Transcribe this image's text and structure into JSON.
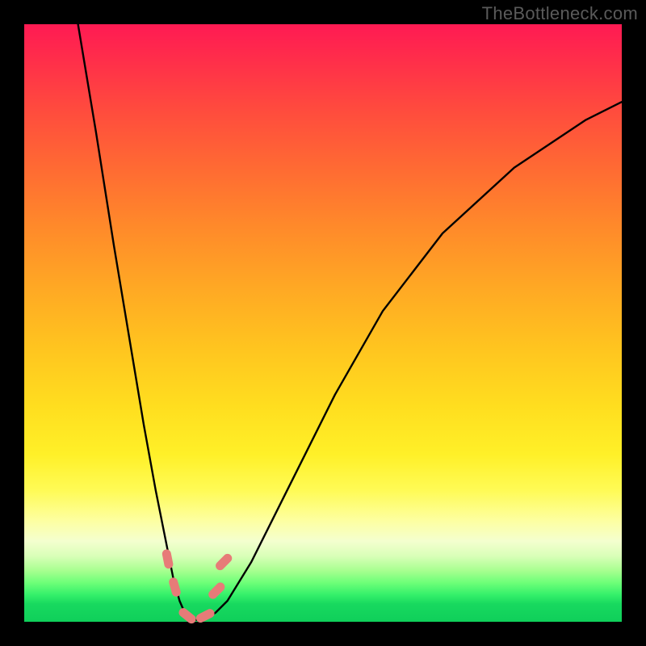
{
  "watermark": "TheBottleneck.com",
  "chart_data": {
    "type": "line",
    "title": "",
    "xlabel": "",
    "ylabel": "",
    "xlim": [
      0,
      100
    ],
    "ylim": [
      0,
      100
    ],
    "grid": false,
    "legend": false,
    "series": [
      {
        "name": "bottleneck-curve",
        "x": [
          9,
          12,
          15,
          18,
          20,
          22,
          24,
          25,
          26,
          27,
          28,
          29,
          30,
          32,
          34,
          38,
          44,
          52,
          60,
          70,
          82,
          94,
          100
        ],
        "y": [
          100,
          82,
          63,
          45,
          33,
          22,
          12,
          7,
          3.5,
          1.2,
          0.4,
          0.3,
          0.5,
          1.5,
          3.5,
          10,
          22,
          38,
          52,
          65,
          76,
          84,
          87
        ],
        "color": "#000000"
      }
    ],
    "markers": [
      {
        "name": "marker-left-upper",
        "x": 24.0,
        "y": 10.5,
        "color": "#e77b78"
      },
      {
        "name": "marker-left-lower",
        "x": 25.2,
        "y": 5.8,
        "color": "#e77b78"
      },
      {
        "name": "marker-bottom-left",
        "x": 27.3,
        "y": 1.0,
        "color": "#e77b78"
      },
      {
        "name": "marker-bottom-right",
        "x": 30.3,
        "y": 1.0,
        "color": "#e77b78"
      },
      {
        "name": "marker-right-lower",
        "x": 32.2,
        "y": 5.2,
        "color": "#e77b78"
      },
      {
        "name": "marker-right-upper",
        "x": 33.4,
        "y": 10.0,
        "color": "#e77b78"
      }
    ]
  }
}
